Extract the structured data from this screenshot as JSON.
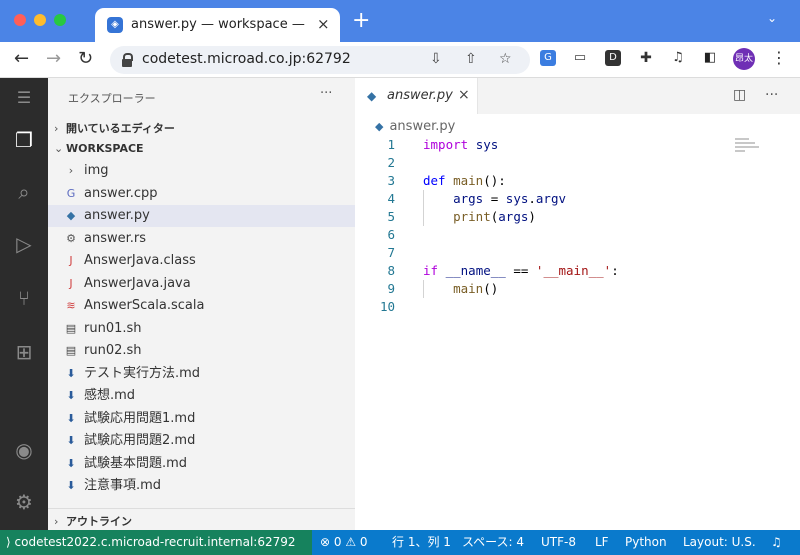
{
  "browser": {
    "tab_title": "answer.py — workspace — Code",
    "url": "codetest.microad.co.jp:62792",
    "avatar": "昂太",
    "ext_d": "D",
    "new_tab": "+",
    "close": "×"
  },
  "sidebar": {
    "title": "エクスプローラー",
    "more": "···",
    "open_editors": "開いているエディター",
    "workspace": "WORKSPACE",
    "outline": "アウトライン",
    "files": [
      {
        "name": "img",
        "icon": "chevron-right-icon",
        "glyph": "›"
      },
      {
        "name": "answer.cpp",
        "icon": "cpp-icon",
        "glyph": "G"
      },
      {
        "name": "answer.py",
        "icon": "python-icon",
        "glyph": "◆"
      },
      {
        "name": "answer.rs",
        "icon": "rust-icon",
        "glyph": "⚙"
      },
      {
        "name": "AnswerJava.class",
        "icon": "java-icon",
        "glyph": "J"
      },
      {
        "name": "AnswerJava.java",
        "icon": "java-icon",
        "glyph": "J"
      },
      {
        "name": "AnswerScala.scala",
        "icon": "scala-icon",
        "glyph": "≋"
      },
      {
        "name": "run01.sh",
        "icon": "shell-icon",
        "glyph": "▤"
      },
      {
        "name": "run02.sh",
        "icon": "shell-icon",
        "glyph": "▤"
      },
      {
        "name": "テスト実行方法.md",
        "icon": "markdown-icon",
        "glyph": "⬇"
      },
      {
        "name": "感想.md",
        "icon": "markdown-icon",
        "glyph": "⬇"
      },
      {
        "name": "試験応用問題1.md",
        "icon": "markdown-icon",
        "glyph": "⬇"
      },
      {
        "name": "試験応用問題2.md",
        "icon": "markdown-icon",
        "glyph": "⬇"
      },
      {
        "name": "試験基本問題.md",
        "icon": "markdown-icon",
        "glyph": "⬇"
      },
      {
        "name": "注意事項.md",
        "icon": "markdown-icon",
        "glyph": "⬇"
      }
    ]
  },
  "editor": {
    "tab": "answer.py",
    "breadcrumb": "answer.py",
    "lines": [
      "1",
      "2",
      "3",
      "4",
      "5",
      "6",
      "7",
      "8",
      "9",
      "10"
    ]
  },
  "colors": {
    "status": "#0a7acc",
    "remote": "#16825d",
    "activity": "#2c2c2c"
  },
  "status": {
    "remote": "codetest2022.c.microad-recruit.internal:62792",
    "problems": "⊗ 0 ⚠ 0",
    "position": "行 1、列 1",
    "spaces": "スペース: 4",
    "encoding": "UTF-8",
    "eol": "LF",
    "language": "Python",
    "layout": "Layout: U.S."
  }
}
